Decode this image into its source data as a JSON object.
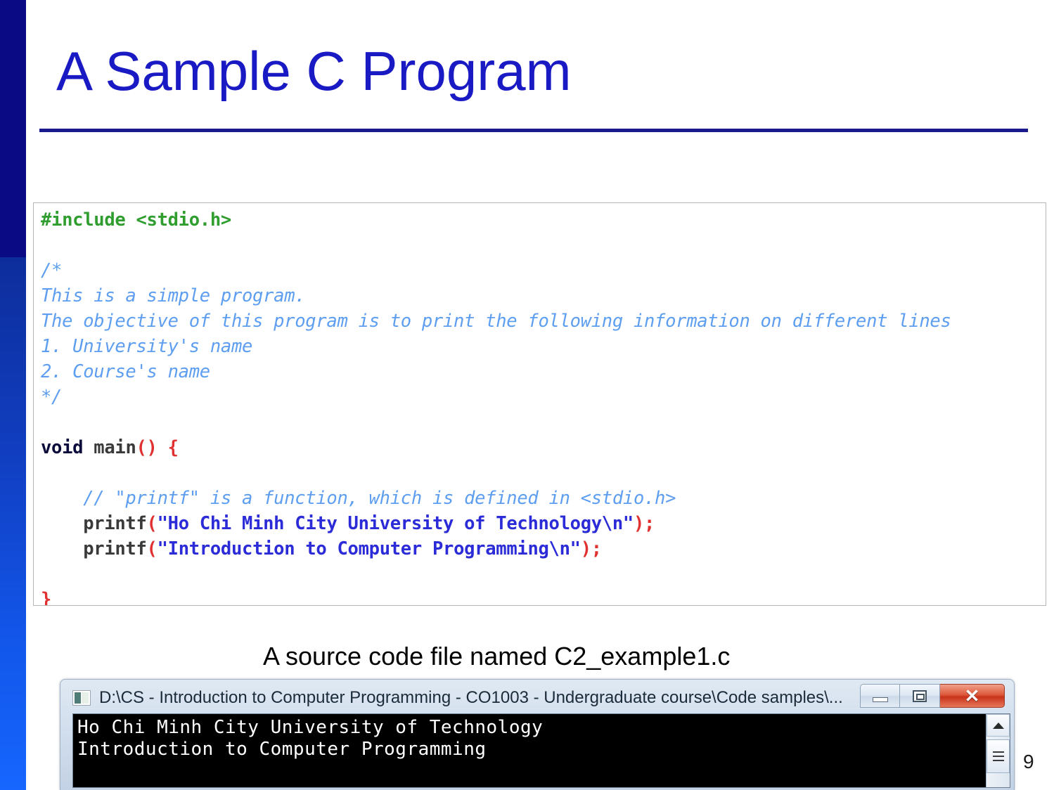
{
  "slide": {
    "title": "A Sample C Program",
    "page_number": "9",
    "accent_color": "#1a1ac4",
    "rule_color": "#1a1a8c",
    "sidebar_top_color": "#0a0a85",
    "sidebar_bottom_color": "#1666ff"
  },
  "code_listing": {
    "language": "c",
    "file_caption": "A source code file named C2_example1.c",
    "lines": [
      "#include <stdio.h>",
      "",
      "/*",
      "This is a simple program.",
      "The objective of this program is to print the following information on different lines",
      "1. University's name",
      "2. Course's name",
      "*/",
      "",
      "void main() {",
      "",
      "    // \"printf\" is a function, which is defined in <stdio.h>",
      "    printf(\"Ho Chi Minh City University of Technology\\n\");",
      "    printf(\"Introduction to Computer Programming\\n\");",
      "",
      "}"
    ],
    "tokens": {
      "preproc": "#include <stdio.h>",
      "comment_open": "/*",
      "comment_line_1": "This is a simple program.",
      "comment_line_2": "The objective of this program is to print the following information on different lines",
      "comment_line_3": "1. University's name",
      "comment_line_4": "2. Course's name",
      "comment_close": "*/",
      "keyword_void": "void",
      "fn_main": "main",
      "punct_parens_open_brace": "() {",
      "inline_comment": "// \"printf\" is a function, which is defined in <stdio.h>",
      "fn_printf": "printf",
      "string_1": "\"Ho Chi Minh City University of Technology\\n\"",
      "string_2": "\"Introduction to Computer Programming\\n\"",
      "close_brace": "}"
    },
    "syntax_colors": {
      "preprocessor": "#2f9e2f",
      "comment": "#5d9ef0",
      "keyword": "#0b0b3b",
      "function": "#3a3a3a",
      "punctuation": "#e03030",
      "string": "#2b2bd8"
    }
  },
  "console_window": {
    "title": "D:\\CS - Introduction to Computer Programming - CO1003 - Undergraduate course\\Code samples\\...",
    "app_icon": "console-icon",
    "controls": {
      "minimize": "minimize-icon",
      "maximize": "maximize-icon",
      "close": "✕"
    },
    "output_lines": [
      "Ho Chi Minh City University of Technology",
      "Introduction to Computer Programming"
    ],
    "output_text": "Ho Chi Minh City University of Technology\nIntroduction to Computer Programming",
    "scrollbar": {
      "up_arrow": "scroll-up-icon",
      "thumb": "scroll-thumb"
    }
  }
}
